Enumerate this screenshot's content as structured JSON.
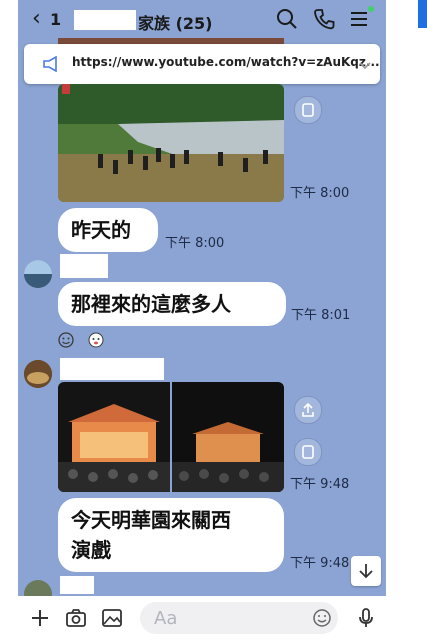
{
  "header": {
    "back_count": "1",
    "title": "家族 (25)",
    "icons": [
      "search-icon",
      "phone-icon",
      "menu-icon"
    ]
  },
  "link_banner": {
    "url": "https://www.youtube.com/watch?v=zAuKqz..."
  },
  "messages": [
    {
      "type": "photo",
      "time": "下午 8:00"
    },
    {
      "type": "text",
      "text": "昨天的",
      "time": "下午 8:00"
    },
    {
      "type": "text",
      "text": "那裡來的這麼多人",
      "time": "下午 8:01"
    },
    {
      "type": "photos",
      "count": 2,
      "time": "下午 9:48"
    },
    {
      "type": "text",
      "text_lines": [
        "今天明華園來關西",
        "演戲"
      ],
      "time": "下午 9:48"
    }
  ],
  "composer": {
    "placeholder": "Aa"
  },
  "colors": {
    "chat_background": "#8ba4d4",
    "bubble": "#ffffff",
    "online_dot": "#3fd16a"
  }
}
